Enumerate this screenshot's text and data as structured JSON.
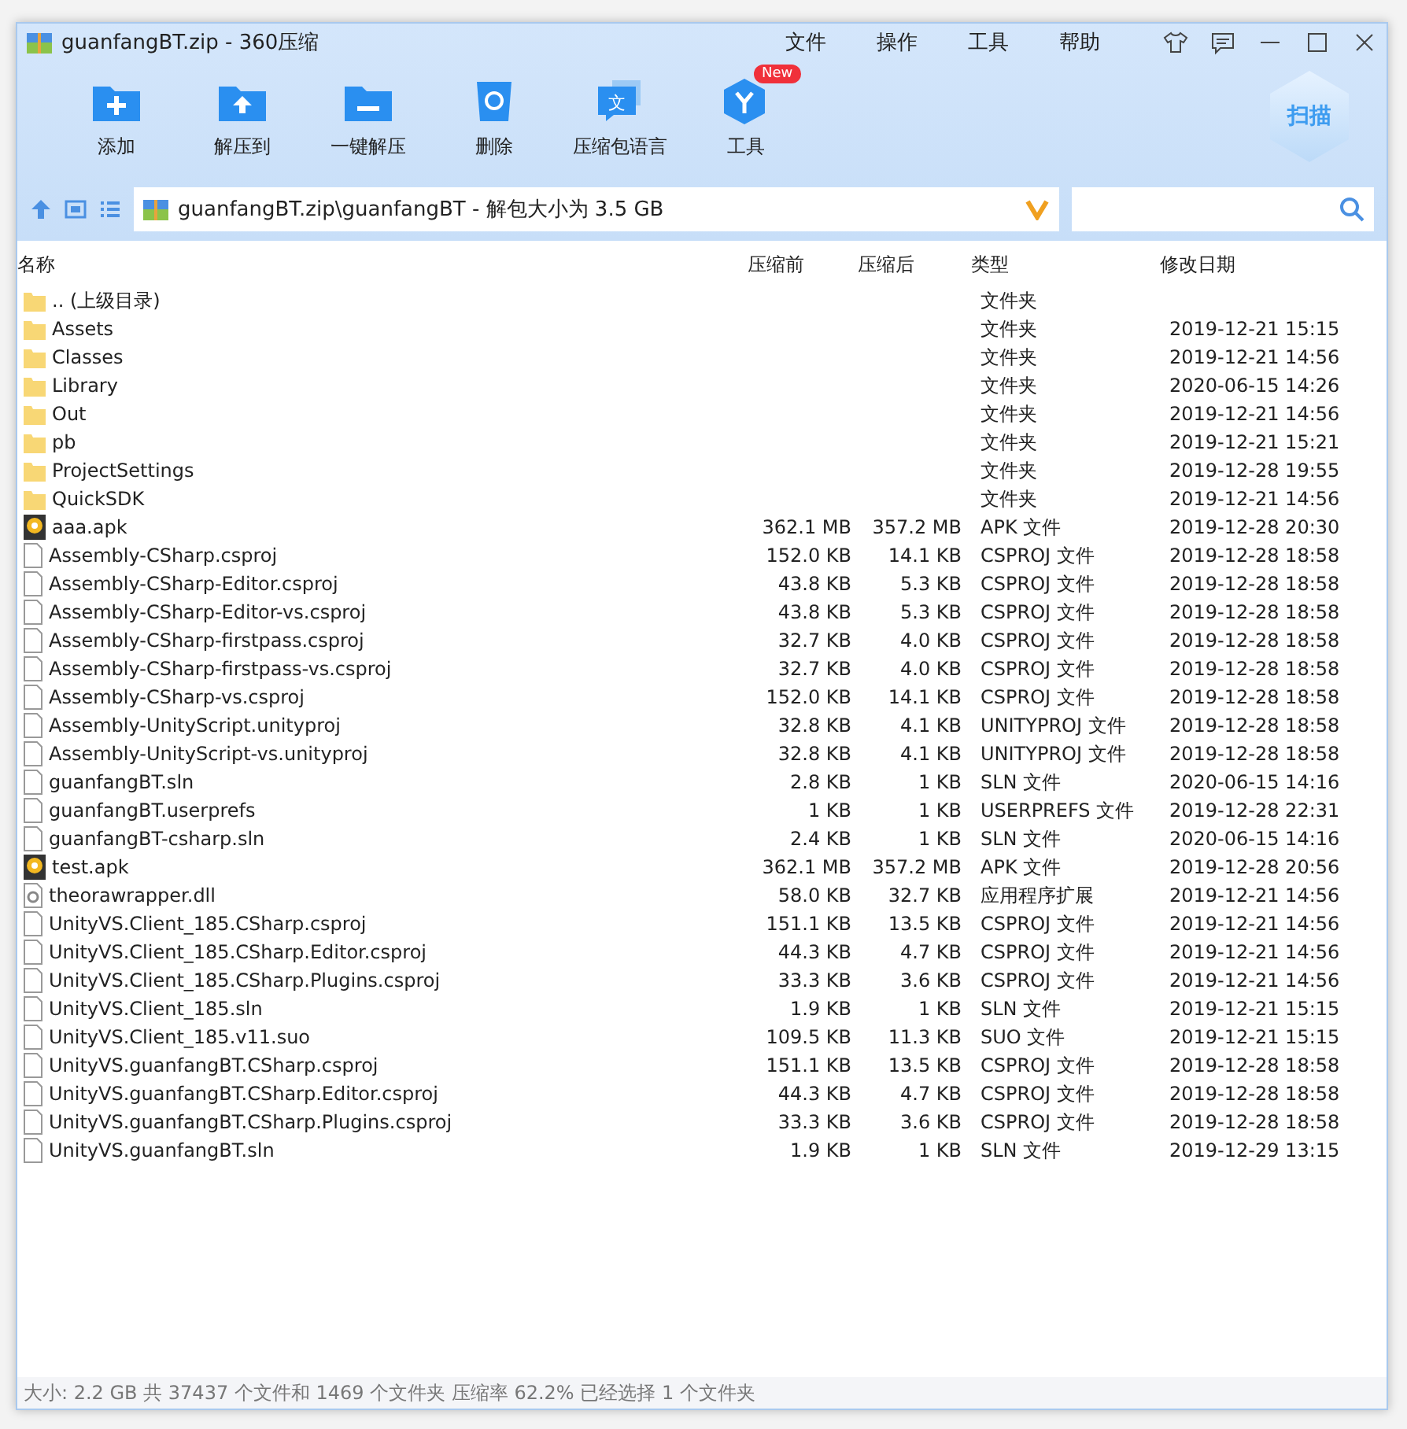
{
  "window": {
    "title": "guanfangBT.zip - 360压缩"
  },
  "menu": [
    "文件",
    "操作",
    "工具",
    "帮助"
  ],
  "toolbar": [
    {
      "kind": "add",
      "label": "添加"
    },
    {
      "kind": "extract",
      "label": "解压到"
    },
    {
      "kind": "oneclick",
      "label": "一键解压"
    },
    {
      "kind": "delete",
      "label": "删除"
    },
    {
      "kind": "language",
      "label": "压缩包语言",
      "glyph": "文"
    },
    {
      "kind": "tools",
      "label": "工具",
      "badge": "New"
    }
  ],
  "scan_button": "扫描",
  "address": {
    "path": "guanfangBT.zip\\guanfangBT - 解包大小为 3.5 GB"
  },
  "table": {
    "columns": [
      "名称",
      "压缩前",
      "压缩后",
      "类型",
      "修改日期"
    ],
    "rows": [
      {
        "kind": "folder",
        "name": ".. (上级目录)",
        "size": "",
        "packed": "",
        "type": "文件夹",
        "date": ""
      },
      {
        "kind": "folder",
        "name": "Assets",
        "size": "",
        "packed": "",
        "type": "文件夹",
        "date": "2019-12-21 15:15"
      },
      {
        "kind": "folder",
        "name": "Classes",
        "size": "",
        "packed": "",
        "type": "文件夹",
        "date": "2019-12-21 14:56"
      },
      {
        "kind": "folder",
        "name": "Library",
        "size": "",
        "packed": "",
        "type": "文件夹",
        "date": "2020-06-15 14:26"
      },
      {
        "kind": "folder",
        "name": "Out",
        "size": "",
        "packed": "",
        "type": "文件夹",
        "date": "2019-12-21 14:56"
      },
      {
        "kind": "folder",
        "name": "pb",
        "size": "",
        "packed": "",
        "type": "文件夹",
        "date": "2019-12-21 15:21"
      },
      {
        "kind": "folder",
        "name": "ProjectSettings",
        "size": "",
        "packed": "",
        "type": "文件夹",
        "date": "2019-12-28 19:55"
      },
      {
        "kind": "folder",
        "name": "QuickSDK",
        "size": "",
        "packed": "",
        "type": "文件夹",
        "date": "2019-12-21 14:56"
      },
      {
        "kind": "apk",
        "name": "aaa.apk",
        "size": "362.1 MB",
        "packed": "357.2 MB",
        "type": "APK 文件",
        "date": "2019-12-28 20:30"
      },
      {
        "kind": "file",
        "name": "Assembly-CSharp.csproj",
        "size": "152.0 KB",
        "packed": "14.1 KB",
        "type": "CSPROJ 文件",
        "date": "2019-12-28 18:58"
      },
      {
        "kind": "file",
        "name": "Assembly-CSharp-Editor.csproj",
        "size": "43.8 KB",
        "packed": "5.3 KB",
        "type": "CSPROJ 文件",
        "date": "2019-12-28 18:58"
      },
      {
        "kind": "file",
        "name": "Assembly-CSharp-Editor-vs.csproj",
        "size": "43.8 KB",
        "packed": "5.3 KB",
        "type": "CSPROJ 文件",
        "date": "2019-12-28 18:58"
      },
      {
        "kind": "file",
        "name": "Assembly-CSharp-firstpass.csproj",
        "size": "32.7 KB",
        "packed": "4.0 KB",
        "type": "CSPROJ 文件",
        "date": "2019-12-28 18:58"
      },
      {
        "kind": "file",
        "name": "Assembly-CSharp-firstpass-vs.csproj",
        "size": "32.7 KB",
        "packed": "4.0 KB",
        "type": "CSPROJ 文件",
        "date": "2019-12-28 18:58"
      },
      {
        "kind": "file",
        "name": "Assembly-CSharp-vs.csproj",
        "size": "152.0 KB",
        "packed": "14.1 KB",
        "type": "CSPROJ 文件",
        "date": "2019-12-28 18:58"
      },
      {
        "kind": "file",
        "name": "Assembly-UnityScript.unityproj",
        "size": "32.8 KB",
        "packed": "4.1 KB",
        "type": "UNITYPROJ 文件",
        "date": "2019-12-28 18:58"
      },
      {
        "kind": "file",
        "name": "Assembly-UnityScript-vs.unityproj",
        "size": "32.8 KB",
        "packed": "4.1 KB",
        "type": "UNITYPROJ 文件",
        "date": "2019-12-28 18:58"
      },
      {
        "kind": "file",
        "name": "guanfangBT.sln",
        "size": "2.8 KB",
        "packed": "1 KB",
        "type": "SLN 文件",
        "date": "2020-06-15 14:16"
      },
      {
        "kind": "file",
        "name": "guanfangBT.userprefs",
        "size": "1 KB",
        "packed": "1 KB",
        "type": "USERPREFS 文件",
        "date": "2019-12-28 22:31"
      },
      {
        "kind": "file",
        "name": "guanfangBT-csharp.sln",
        "size": "2.4 KB",
        "packed": "1 KB",
        "type": "SLN 文件",
        "date": "2020-06-15 14:16"
      },
      {
        "kind": "apk",
        "name": "test.apk",
        "size": "362.1 MB",
        "packed": "357.2 MB",
        "type": "APK 文件",
        "date": "2019-12-28 20:56"
      },
      {
        "kind": "dll",
        "name": "theorawrapper.dll",
        "size": "58.0 KB",
        "packed": "32.7 KB",
        "type": "应用程序扩展",
        "date": "2019-12-21 14:56"
      },
      {
        "kind": "file",
        "name": "UnityVS.Client_185.CSharp.csproj",
        "size": "151.1 KB",
        "packed": "13.5 KB",
        "type": "CSPROJ 文件",
        "date": "2019-12-21 14:56"
      },
      {
        "kind": "file",
        "name": "UnityVS.Client_185.CSharp.Editor.csproj",
        "size": "44.3 KB",
        "packed": "4.7 KB",
        "type": "CSPROJ 文件",
        "date": "2019-12-21 14:56"
      },
      {
        "kind": "file",
        "name": "UnityVS.Client_185.CSharp.Plugins.csproj",
        "size": "33.3 KB",
        "packed": "3.6 KB",
        "type": "CSPROJ 文件",
        "date": "2019-12-21 14:56"
      },
      {
        "kind": "file",
        "name": "UnityVS.Client_185.sln",
        "size": "1.9 KB",
        "packed": "1 KB",
        "type": "SLN 文件",
        "date": "2019-12-21 15:15"
      },
      {
        "kind": "file",
        "name": "UnityVS.Client_185.v11.suo",
        "size": "109.5 KB",
        "packed": "11.3 KB",
        "type": "SUO 文件",
        "date": "2019-12-21 15:15"
      },
      {
        "kind": "file",
        "name": "UnityVS.guanfangBT.CSharp.csproj",
        "size": "151.1 KB",
        "packed": "13.5 KB",
        "type": "CSPROJ 文件",
        "date": "2019-12-28 18:58"
      },
      {
        "kind": "file",
        "name": "UnityVS.guanfangBT.CSharp.Editor.csproj",
        "size": "44.3 KB",
        "packed": "4.7 KB",
        "type": "CSPROJ 文件",
        "date": "2019-12-28 18:58"
      },
      {
        "kind": "file",
        "name": "UnityVS.guanfangBT.CSharp.Plugins.csproj",
        "size": "33.3 KB",
        "packed": "3.6 KB",
        "type": "CSPROJ 文件",
        "date": "2019-12-28 18:58"
      },
      {
        "kind": "file",
        "name": "UnityVS.guanfangBT.sln",
        "size": "1.9 KB",
        "packed": "1 KB",
        "type": "SLN 文件",
        "date": "2019-12-29 13:15"
      }
    ]
  },
  "status_bar": "大小: 2.2 GB 共 37437 个文件和 1469 个文件夹 压缩率 62.2% 已经选择 1 个文件夹"
}
